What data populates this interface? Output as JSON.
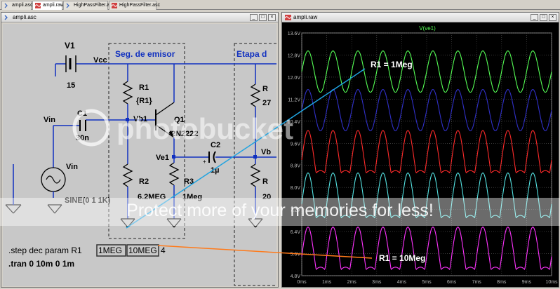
{
  "tabs": [
    {
      "label": "ampli.asc",
      "active": false
    },
    {
      "label": "ampli.raw",
      "active": true
    },
    {
      "label": "HighPassFilter.asc",
      "active": false
    },
    {
      "label": "HighPassFilter.asc",
      "active": false
    }
  ],
  "schematic_window": {
    "title": "ampli.asc",
    "buttons": [
      "_",
      "□",
      "×"
    ]
  },
  "waveform_window": {
    "title": "ampli.raw",
    "buttons": [
      "_",
      "□",
      "×"
    ],
    "trace_label": "V(ve1)"
  },
  "schematic": {
    "section_emitter": "Seg. de emisor",
    "section_stage": "Etapa d",
    "V1": {
      "name": "V1",
      "value": "15",
      "net": "Vcc"
    },
    "R1": {
      "name": "R1",
      "value": "{R1}"
    },
    "Q1": {
      "name": "Q1",
      "value": "2N2222"
    },
    "Vb1": "Vb1",
    "Ve1": "Ve1",
    "C1": {
      "name": "C1",
      "value": "30n"
    },
    "C2": {
      "name": "C2",
      "value": "1µ"
    },
    "R2": {
      "name": "R2",
      "value": "6.2MEG"
    },
    "R3": {
      "name": "R3",
      "value": "1Meg"
    },
    "R_right_top": {
      "name": "R",
      "value": "27"
    },
    "R_right_bottom": {
      "name": "R",
      "value": "20"
    },
    "Vb_right": "Vb",
    "Vin_net": "Vin",
    "Vin_source": {
      "name": "Vin",
      "value": "SINE(0 1 1K)"
    },
    "step_prefix": ".step dec param R1",
    "step_v1": "1MEG",
    "step_v2": "10MEG",
    "step_suffix": "4",
    "tran": ".tran 0 10m 0 1m"
  },
  "chart_data": {
    "type": "line",
    "title": "V(ve1)",
    "xlabel": "",
    "ylabel": "",
    "x_ticks": [
      "0ms",
      "1ms",
      "2ms",
      "3ms",
      "4ms",
      "5ms",
      "6ms",
      "7ms",
      "8ms",
      "9ms",
      "10ms"
    ],
    "y_ticks": [
      "4.8V",
      "5.6V",
      "6.4V",
      "7.2V",
      "8.0V",
      "8.8V",
      "9.6V",
      "10.4V",
      "11.2V",
      "12.0V",
      "12.8V",
      "13.6V"
    ],
    "xlim": [
      0,
      10
    ],
    "ylim": [
      4.8,
      13.6
    ],
    "grid": true,
    "frequency_khz": 1,
    "series": [
      {
        "color": "#55ff55",
        "center": 12.2,
        "amplitude": 0.75,
        "shape": "sine"
      },
      {
        "color": "#3030c8",
        "center": 10.8,
        "amplitude": 0.75,
        "shape": "sine"
      },
      {
        "color": "#ff2a2a",
        "center": 9.0,
        "amplitude": 0.85,
        "shape": "clipped"
      },
      {
        "color": "#55e5e5",
        "center": 7.4,
        "amplitude": 0.9,
        "shape": "clipped"
      },
      {
        "color": "#ff33ff",
        "center": 5.5,
        "amplitude": 0.85,
        "shape": "clipped"
      }
    ]
  },
  "annotations": {
    "r1_low": "R1 = 1Meg",
    "r1_high": "R1 =  10Meg",
    "line_colors": {
      "r1_low": "#1fa3e0",
      "r1_high": "#ff7a1a"
    }
  },
  "watermark": {
    "logo": "photobucket",
    "text": "Protect more of your memories for less!"
  }
}
